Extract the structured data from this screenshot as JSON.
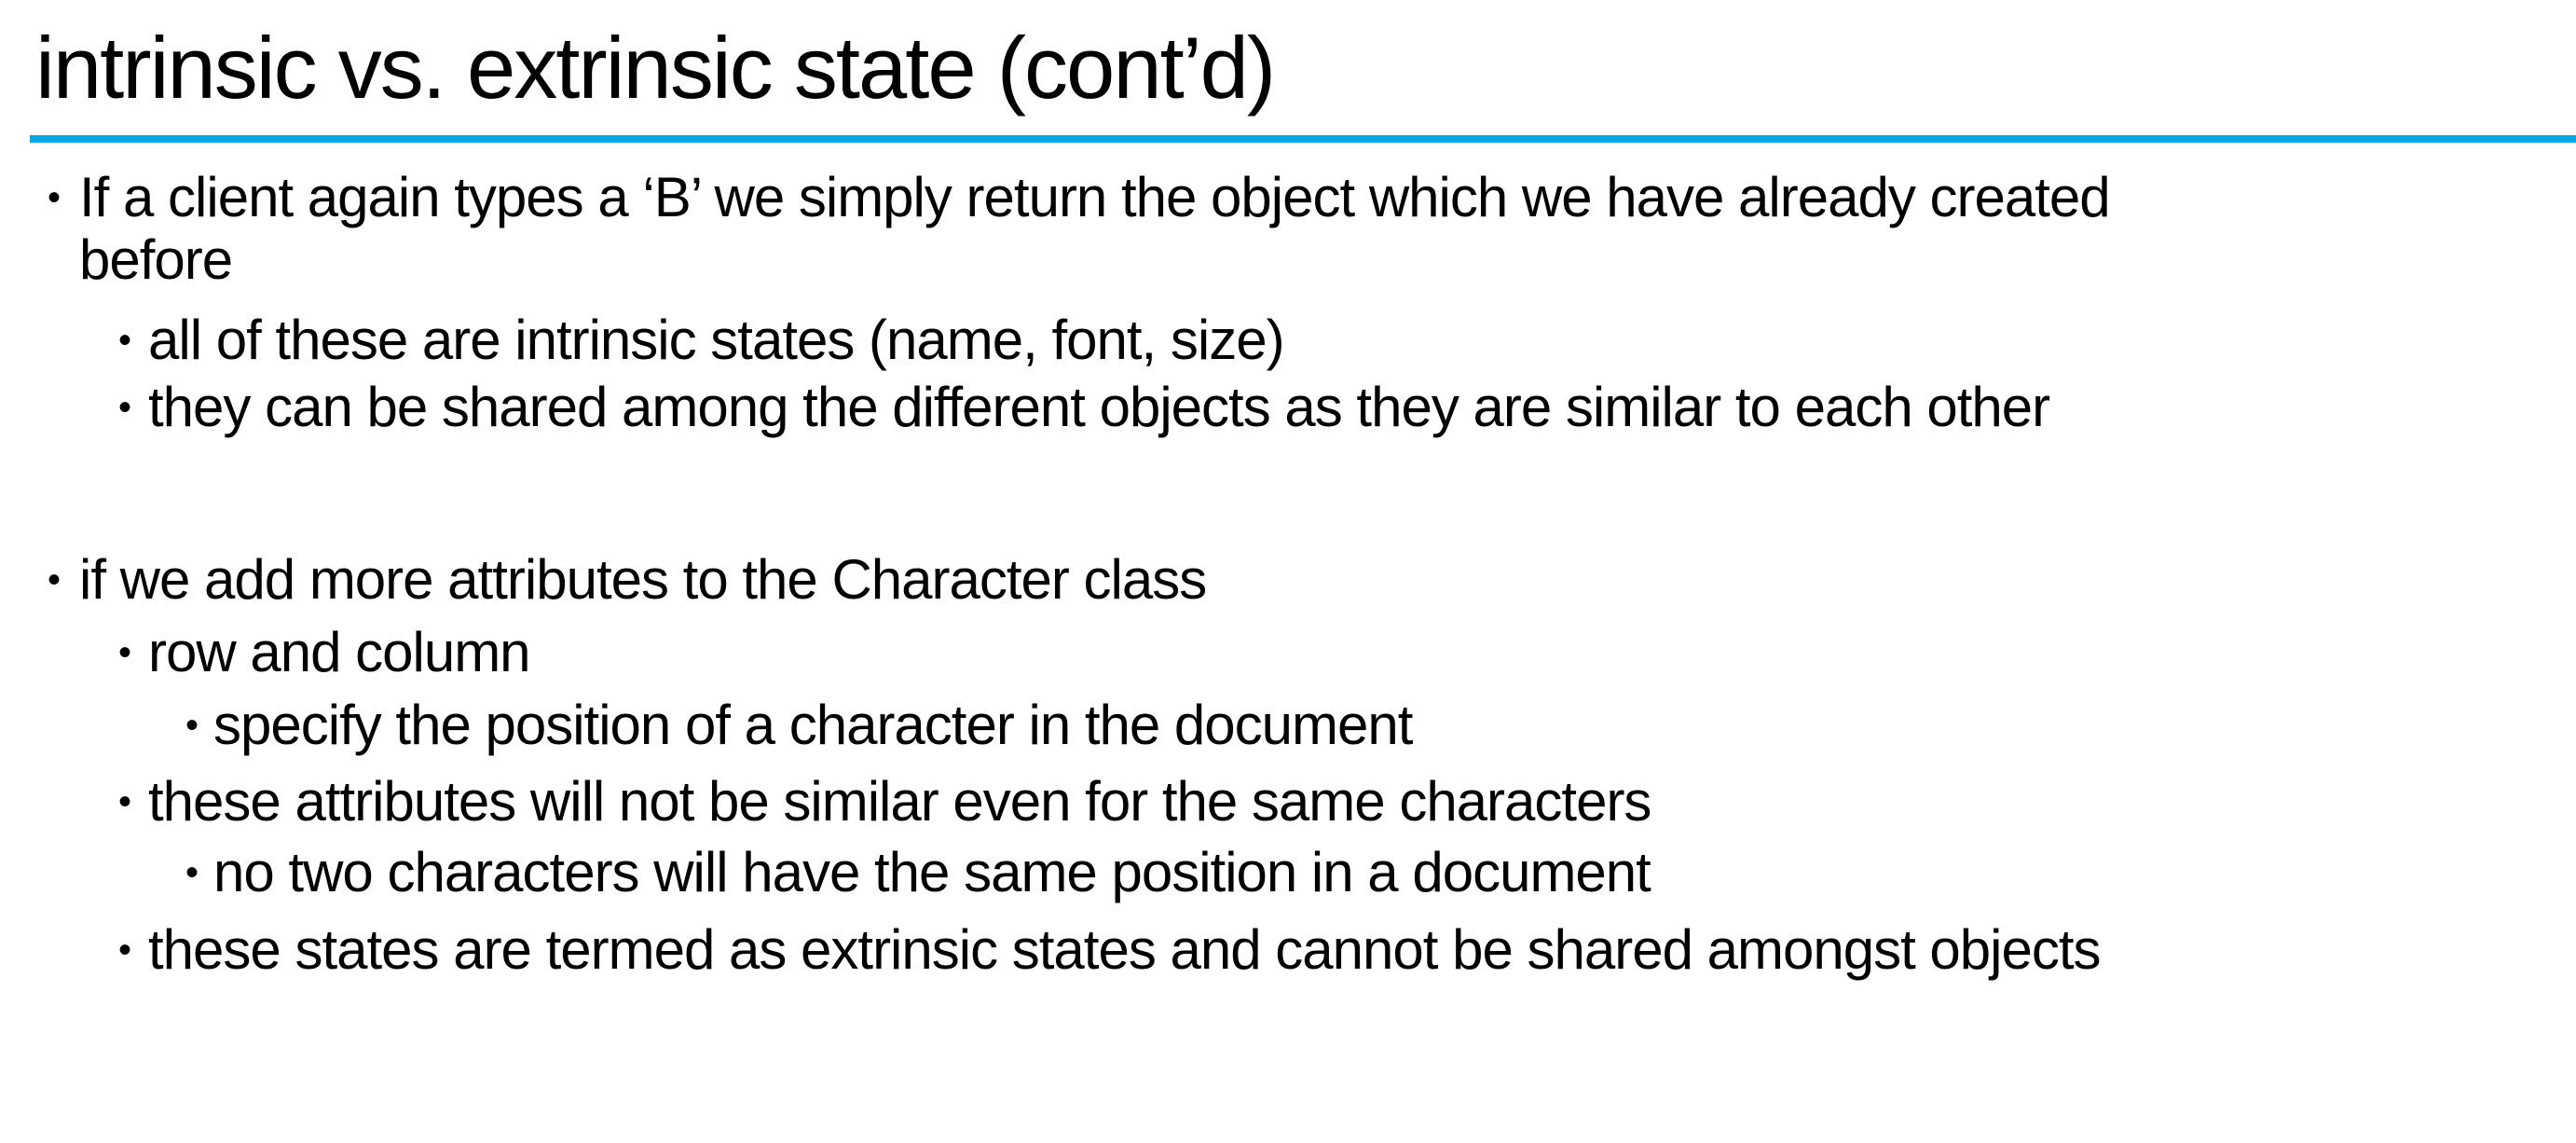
{
  "slide": {
    "title": "intrinsic vs. extrinsic state (cont’d)",
    "accent_color": "#00a8e8",
    "bullet_char": "•",
    "lines": [
      {
        "level": 1,
        "text": "If a client again types a ‘B’ we simply return the object which we have already created",
        "bullet": true
      },
      {
        "level": 1,
        "text": "before",
        "bullet": false
      },
      {
        "level": 2,
        "text": "all of these are intrinsic states (name, font, size)",
        "bullet": true
      },
      {
        "level": 2,
        "text": "they can be shared among the different objects as they are similar to each other",
        "bullet": true
      },
      {
        "level": 1,
        "text": "if we add more attributes to the Character class",
        "bullet": true
      },
      {
        "level": 2,
        "text": "row and column",
        "bullet": true
      },
      {
        "level": 3,
        "text": "specify the position of a character in the document",
        "bullet": true
      },
      {
        "level": 2,
        "text": "these attributes will not be similar even for the same characters",
        "bullet": true
      },
      {
        "level": 3,
        "text": "no two characters will have the same position in a document",
        "bullet": true
      },
      {
        "level": 2,
        "text": "these states are termed as extrinsic states and cannot be shared amongst objects",
        "bullet": true
      }
    ]
  }
}
